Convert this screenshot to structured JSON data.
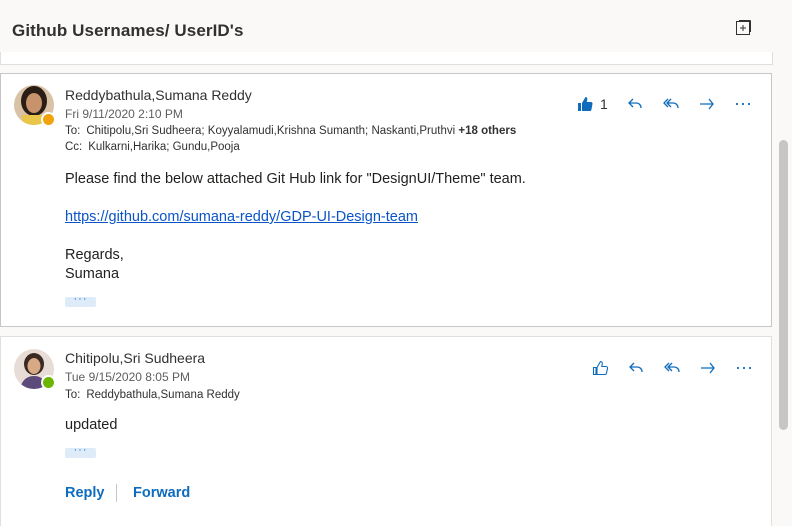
{
  "header": {
    "title": "Github Usernames/ UserID's"
  },
  "messages": [
    {
      "sender": "Reddybathula,Sumana Reddy",
      "date": "Fri 9/11/2020 2:10 PM",
      "to_label": "To:",
      "to": "Chitipolu,Sri Sudheera; Koyyalamudi,Krishna Sumanth; Naskanti,Pruthvi",
      "to_more": "+18 others",
      "cc_label": "Cc:",
      "cc": "Kulkarni,Harika; Gundu,Pooja",
      "like_count": "1",
      "body_line1": "Please find the below attached Git Hub link for \"DesignUI/Theme\" team.",
      "link": "https://github.com/sumana-reddy/GDP-UI-Design-team",
      "closing": "Regards,",
      "signature": "Sumana",
      "ellipsis": "···",
      "presence_color": "#f0a30a"
    },
    {
      "sender": "Chitipolu,Sri Sudheera",
      "date": "Tue 9/15/2020 8:05 PM",
      "to_label": "To:",
      "to": "Reddybathula,Sumana Reddy",
      "body_line1": "updated",
      "ellipsis": "···",
      "presence_color": "#6bb700"
    }
  ],
  "footer": {
    "reply_label": "Reply",
    "forward_label": "Forward"
  },
  "colors": {
    "accent": "#0f6cbd",
    "link": "#0b54c7"
  },
  "icons": [
    "popout-icon",
    "like-icon",
    "reply-icon",
    "reply-all-icon",
    "forward-icon",
    "more-icon"
  ]
}
